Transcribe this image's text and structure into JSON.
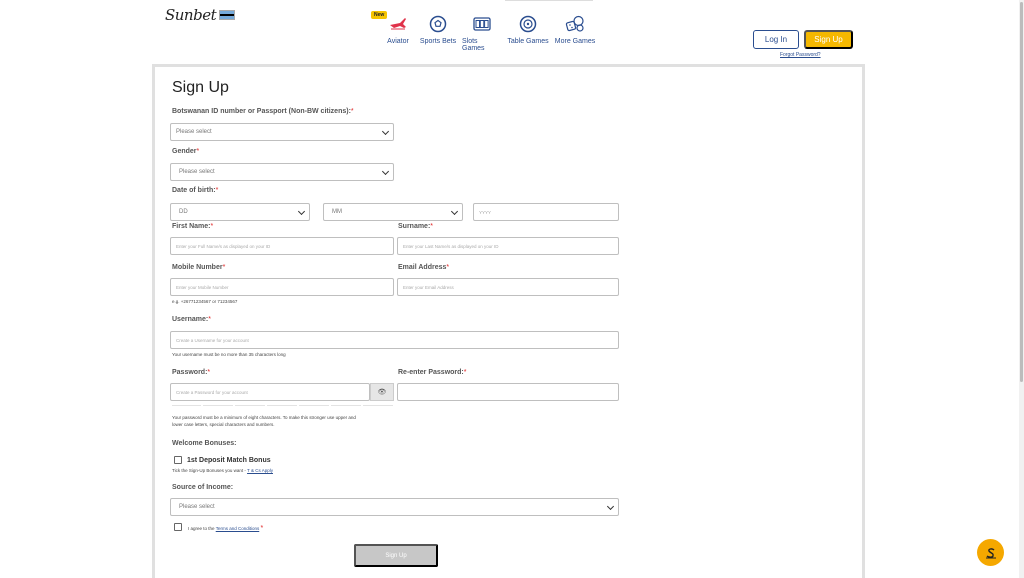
{
  "header": {
    "logo_text": "Sunbet",
    "flag_colors": [
      "#75aadb",
      "#ffffff",
      "#000000",
      "#ffffff",
      "#75aadb"
    ],
    "nav": [
      {
        "label": "Aviator",
        "icon": "plane-icon",
        "badge": "New"
      },
      {
        "label": "Sports Bets",
        "icon": "soccer-ball-icon"
      },
      {
        "label": "Slots Games",
        "icon": "slot-machine-icon"
      },
      {
        "label": "Table Games",
        "icon": "roulette-icon"
      },
      {
        "label": "More Games",
        "icon": "dice-icon"
      }
    ],
    "login_label": "Log In",
    "signup_label": "Sign Up",
    "forgot_label": "Forgot Password?"
  },
  "form": {
    "title": "Sign Up",
    "id_type": {
      "label": "Botswanan ID number or Passport (Non-BW citizens):",
      "value": "Please select"
    },
    "gender": {
      "label": "Gender",
      "value": "Please select"
    },
    "dob": {
      "label": "Date of birth:",
      "day": "DD",
      "month": "MM",
      "year_placeholder": "YYYY"
    },
    "first_name": {
      "label": "First Name:",
      "placeholder": "Enter your Full Name/s as displayed on your ID"
    },
    "surname": {
      "label": "Surname:",
      "placeholder": "Enter your Last Name/s as displayed on your ID"
    },
    "mobile": {
      "label": "Mobile Number",
      "placeholder": "Enter your Mobile Number",
      "hint": "e.g. +26771234567 or 71234567"
    },
    "email": {
      "label": "Email Address",
      "placeholder": "Enter your Email Address"
    },
    "username": {
      "label": "Username:",
      "placeholder": "Create a Username for your account",
      "hint": "Your username must be no more than 35 characters long"
    },
    "password": {
      "label": "Password:",
      "placeholder": "Create a Password for your account",
      "hint_line1": "Your password must be a minimum of eight characters. To make this stronger use upper and",
      "hint_line2": "lower case letters, special characters and numbers."
    },
    "reenter_password": {
      "label": "Re-enter Password:",
      "placeholder": ""
    },
    "bonuses": {
      "label": "Welcome Bonuses:",
      "option": "1st Deposit Match Bonus",
      "hint": "Tick the Sign-Up Bonuses you want -",
      "link": "T & Cs Apply"
    },
    "income": {
      "label": "Source of Income:",
      "value": "Please select"
    },
    "terms": {
      "text": "I agree to the",
      "link": "Terms and Conditions"
    },
    "submit_label": "Sign Up",
    "required_mark": "*"
  },
  "colors": {
    "accent": "#f5b800",
    "link": "#2a4d8f",
    "required": "#e02020"
  }
}
